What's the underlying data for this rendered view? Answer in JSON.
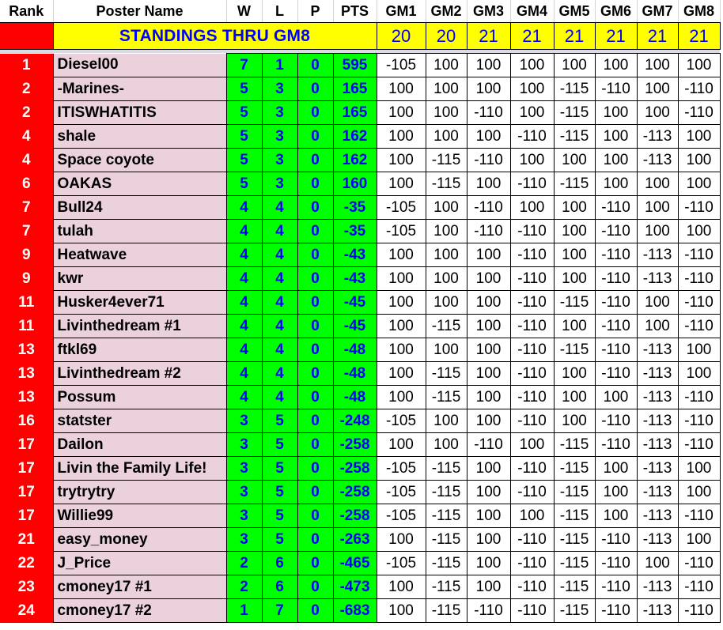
{
  "headers": {
    "rank": "Rank",
    "name": "Poster Name",
    "w": "W",
    "l": "L",
    "p": "P",
    "pts": "PTS",
    "games": [
      "GM1",
      "GM2",
      "GM3",
      "GM4",
      "GM5",
      "GM6",
      "GM7",
      "GM8"
    ]
  },
  "title": "STANDINGS THRU GM8",
  "game_counts": [
    "20",
    "20",
    "21",
    "21",
    "21",
    "21",
    "21",
    "21"
  ],
  "colors": {
    "rank_bg": "#ff0000",
    "name_bg": "#ead1dc",
    "stat_bg": "#00ff00",
    "stat_text": "#0000ff",
    "title_bg": "#ffff00",
    "title_text": "#0000ff"
  },
  "rows": [
    {
      "rank": "1",
      "name": "Diesel00",
      "w": "7",
      "l": "1",
      "p": "0",
      "pts": "595",
      "games": [
        "-105",
        "100",
        "100",
        "100",
        "100",
        "100",
        "100",
        "100"
      ]
    },
    {
      "rank": "2",
      "name": "-Marines-",
      "w": "5",
      "l": "3",
      "p": "0",
      "pts": "165",
      "games": [
        "100",
        "100",
        "100",
        "100",
        "-115",
        "-110",
        "100",
        "-110"
      ]
    },
    {
      "rank": "2",
      "name": "ITISWHATITIS",
      "w": "5",
      "l": "3",
      "p": "0",
      "pts": "165",
      "games": [
        "100",
        "100",
        "-110",
        "100",
        "-115",
        "100",
        "100",
        "-110"
      ]
    },
    {
      "rank": "4",
      "name": "shale",
      "w": "5",
      "l": "3",
      "p": "0",
      "pts": "162",
      "games": [
        "100",
        "100",
        "100",
        "-110",
        "-115",
        "100",
        "-113",
        "100"
      ]
    },
    {
      "rank": "4",
      "name": "Space coyote",
      "w": "5",
      "l": "3",
      "p": "0",
      "pts": "162",
      "games": [
        "100",
        "-115",
        "-110",
        "100",
        "100",
        "100",
        "-113",
        "100"
      ]
    },
    {
      "rank": "6",
      "name": "OAKAS",
      "w": "5",
      "l": "3",
      "p": "0",
      "pts": "160",
      "games": [
        "100",
        "-115",
        "100",
        "-110",
        "-115",
        "100",
        "100",
        "100"
      ]
    },
    {
      "rank": "7",
      "name": "Bull24",
      "w": "4",
      "l": "4",
      "p": "0",
      "pts": "-35",
      "games": [
        "-105",
        "100",
        "-110",
        "100",
        "100",
        "-110",
        "100",
        "-110"
      ]
    },
    {
      "rank": "7",
      "name": "tulah",
      "w": "4",
      "l": "4",
      "p": "0",
      "pts": "-35",
      "games": [
        "-105",
        "100",
        "-110",
        "-110",
        "100",
        "-110",
        "100",
        "100"
      ]
    },
    {
      "rank": "9",
      "name": "Heatwave",
      "w": "4",
      "l": "4",
      "p": "0",
      "pts": "-43",
      "games": [
        "100",
        "100",
        "100",
        "-110",
        "100",
        "-110",
        "-113",
        "-110"
      ]
    },
    {
      "rank": "9",
      "name": "kwr",
      "w": "4",
      "l": "4",
      "p": "0",
      "pts": "-43",
      "games": [
        "100",
        "100",
        "100",
        "-110",
        "100",
        "-110",
        "-113",
        "-110"
      ]
    },
    {
      "rank": "11",
      "name": "Husker4ever71",
      "w": "4",
      "l": "4",
      "p": "0",
      "pts": "-45",
      "games": [
        "100",
        "100",
        "100",
        "-110",
        "-115",
        "-110",
        "100",
        "-110"
      ]
    },
    {
      "rank": "11",
      "name": "Livinthedream #1",
      "w": "4",
      "l": "4",
      "p": "0",
      "pts": "-45",
      "games": [
        "100",
        "-115",
        "100",
        "-110",
        "100",
        "-110",
        "100",
        "-110"
      ]
    },
    {
      "rank": "13",
      "name": "ftkl69",
      "w": "4",
      "l": "4",
      "p": "0",
      "pts": "-48",
      "games": [
        "100",
        "100",
        "100",
        "-110",
        "-115",
        "-110",
        "-113",
        "100"
      ]
    },
    {
      "rank": "13",
      "name": "Livinthedream #2",
      "w": "4",
      "l": "4",
      "p": "0",
      "pts": "-48",
      "games": [
        "100",
        "-115",
        "100",
        "-110",
        "100",
        "-110",
        "-113",
        "100"
      ]
    },
    {
      "rank": "13",
      "name": "Possum",
      "w": "4",
      "l": "4",
      "p": "0",
      "pts": "-48",
      "games": [
        "100",
        "-115",
        "100",
        "-110",
        "100",
        "100",
        "-113",
        "-110"
      ]
    },
    {
      "rank": "16",
      "name": "statster",
      "w": "3",
      "l": "5",
      "p": "0",
      "pts": "-248",
      "games": [
        "-105",
        "100",
        "100",
        "-110",
        "100",
        "-110",
        "-113",
        "-110"
      ]
    },
    {
      "rank": "17",
      "name": "Dailon",
      "w": "3",
      "l": "5",
      "p": "0",
      "pts": "-258",
      "games": [
        "100",
        "100",
        "-110",
        "100",
        "-115",
        "-110",
        "-113",
        "-110"
      ]
    },
    {
      "rank": "17",
      "name": "Livin the Family Life!",
      "w": "3",
      "l": "5",
      "p": "0",
      "pts": "-258",
      "games": [
        "-105",
        "-115",
        "100",
        "-110",
        "-115",
        "100",
        "-113",
        "100"
      ]
    },
    {
      "rank": "17",
      "name": "trytrytry",
      "w": "3",
      "l": "5",
      "p": "0",
      "pts": "-258",
      "games": [
        "-105",
        "-115",
        "100",
        "-110",
        "-115",
        "100",
        "-113",
        "100"
      ]
    },
    {
      "rank": "17",
      "name": "Willie99",
      "w": "3",
      "l": "5",
      "p": "0",
      "pts": "-258",
      "games": [
        "-105",
        "-115",
        "100",
        "100",
        "-115",
        "100",
        "-113",
        "-110"
      ]
    },
    {
      "rank": "21",
      "name": "easy_money",
      "w": "3",
      "l": "5",
      "p": "0",
      "pts": "-263",
      "games": [
        "100",
        "-115",
        "100",
        "-110",
        "-115",
        "-110",
        "-113",
        "100"
      ]
    },
    {
      "rank": "22",
      "name": "J_Price",
      "w": "2",
      "l": "6",
      "p": "0",
      "pts": "-465",
      "games": [
        "-105",
        "-115",
        "100",
        "-110",
        "-115",
        "-110",
        "100",
        "-110"
      ]
    },
    {
      "rank": "23",
      "name": "cmoney17 #1",
      "w": "2",
      "l": "6",
      "p": "0",
      "pts": "-473",
      "games": [
        "100",
        "-115",
        "100",
        "-110",
        "-115",
        "-110",
        "-113",
        "-110"
      ]
    },
    {
      "rank": "24",
      "name": "cmoney17 #2",
      "w": "1",
      "l": "7",
      "p": "0",
      "pts": "-683",
      "games": [
        "100",
        "-115",
        "-110",
        "-110",
        "-115",
        "-110",
        "-113",
        "-110"
      ]
    }
  ]
}
